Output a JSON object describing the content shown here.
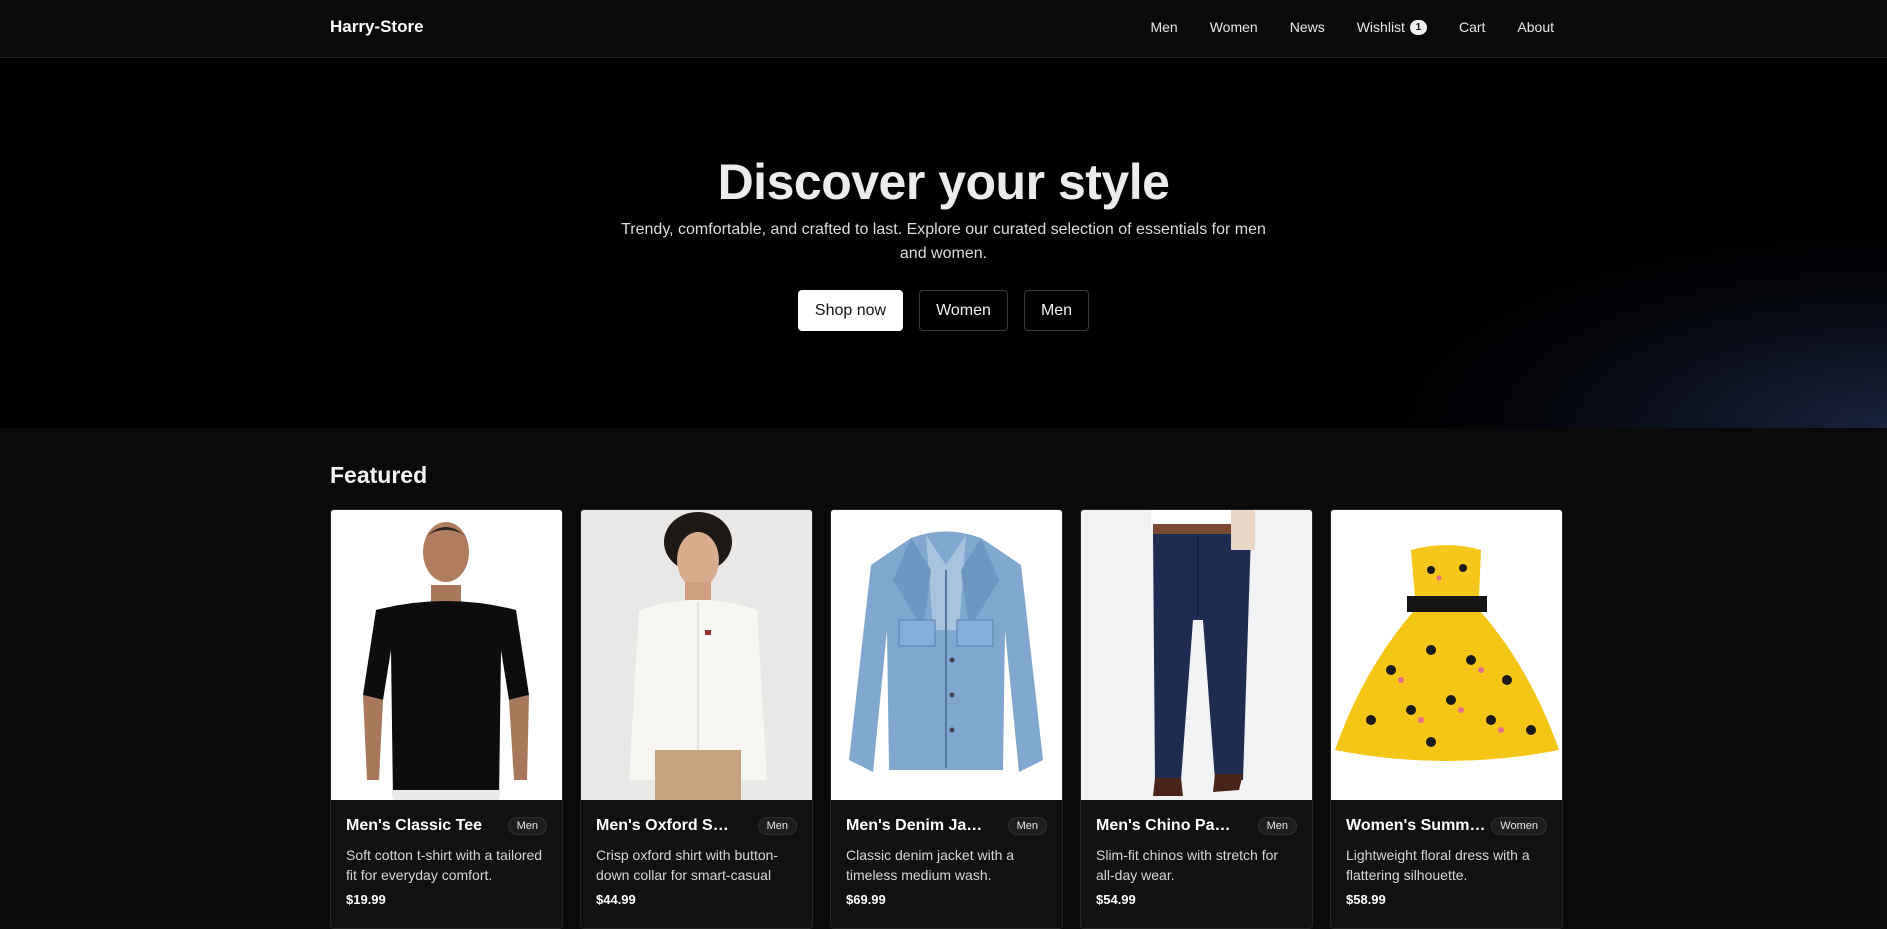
{
  "nav": {
    "brand": "Harry-Store",
    "links": [
      {
        "label": "Men"
      },
      {
        "label": "Women"
      },
      {
        "label": "News"
      },
      {
        "label": "Wishlist",
        "badge": "1"
      },
      {
        "label": "Cart"
      },
      {
        "label": "About"
      }
    ]
  },
  "hero": {
    "title": "Discover your style",
    "subtitle": "Trendy, comfortable, and crafted to last. Explore our curated selection of essentials for men and women.",
    "buttons": {
      "primary": "Shop now",
      "women": "Women",
      "men": "Men"
    }
  },
  "featured": {
    "title": "Featured",
    "products": [
      {
        "name": "Men's Classic Tee",
        "tag": "Men",
        "description": "Soft cotton t-shirt with a tailored fit for everyday comfort.",
        "price": "$19.99",
        "image_icon": "black-tshirt-model-icon"
      },
      {
        "name": "Men's Oxford Shirt",
        "tag": "Men",
        "description": "Crisp oxford shirt with button-down collar for smart-casual looks.",
        "price": "$44.99",
        "image_icon": "white-shirt-model-icon"
      },
      {
        "name": "Men's Denim Jacket",
        "tag": "Men",
        "description": "Classic denim jacket with a timeless medium wash.",
        "price": "$69.99",
        "image_icon": "denim-jacket-icon"
      },
      {
        "name": "Men's Chino Pants",
        "tag": "Men",
        "description": "Slim-fit chinos with stretch for all-day wear.",
        "price": "$54.99",
        "image_icon": "navy-chinos-icon"
      },
      {
        "name": "Women's Summer Dress",
        "tag": "Women",
        "description": "Lightweight floral dress with a flattering silhouette.",
        "price": "$58.99",
        "image_icon": "yellow-floral-dress-icon"
      }
    ]
  },
  "colors": {
    "background": "#0a0a0a",
    "hero_background": "#000000",
    "hero_glow": "#1c2848",
    "primary_button": "#ffffff",
    "text": "#f2f2f2"
  }
}
